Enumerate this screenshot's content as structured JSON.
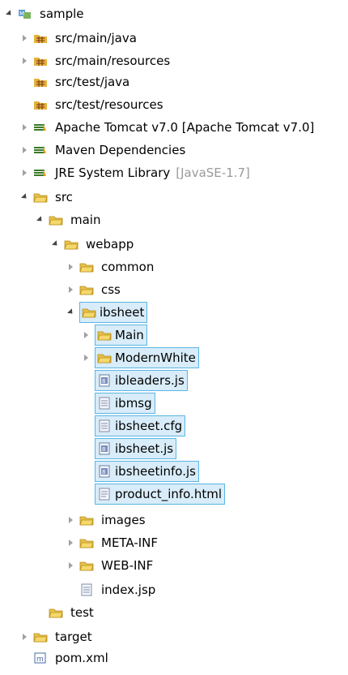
{
  "tree": [
    {
      "label": "sample",
      "icon": "maven-project-icon",
      "arrow": "open",
      "indent": 0,
      "selected": false
    },
    {
      "label": "src/main/java",
      "icon": "source-folder-icon",
      "arrow": "closed",
      "indent": 1,
      "selected": false
    },
    {
      "label": "src/main/resources",
      "icon": "source-folder-icon",
      "arrow": "closed",
      "indent": 1,
      "selected": false
    },
    {
      "label": "src/test/java",
      "icon": "source-folder-icon",
      "arrow": "none",
      "indent": 1,
      "selected": false
    },
    {
      "label": "src/test/resources",
      "icon": "source-folder-icon",
      "arrow": "none",
      "indent": 1,
      "selected": false
    },
    {
      "label": "Apache Tomcat v7.0 [Apache Tomcat v7.0]",
      "icon": "library-icon",
      "arrow": "closed",
      "indent": 1,
      "selected": false
    },
    {
      "label": "Maven Dependencies",
      "icon": "library-icon",
      "arrow": "closed",
      "indent": 1,
      "selected": false
    },
    {
      "label": "JRE System Library",
      "suffix": "[JavaSE-1.7]",
      "icon": "library-icon",
      "arrow": "closed",
      "indent": 1,
      "selected": false
    },
    {
      "label": "src",
      "icon": "folder-icon",
      "arrow": "open",
      "indent": 1,
      "selected": false
    },
    {
      "label": "main",
      "icon": "folder-icon",
      "arrow": "open",
      "indent": 2,
      "selected": false
    },
    {
      "label": "webapp",
      "icon": "folder-icon",
      "arrow": "open",
      "indent": 3,
      "selected": false
    },
    {
      "label": "common",
      "icon": "folder-icon",
      "arrow": "closed",
      "indent": 4,
      "selected": false
    },
    {
      "label": "css",
      "icon": "folder-icon",
      "arrow": "closed",
      "indent": 4,
      "selected": false
    },
    {
      "label": "ibsheet",
      "icon": "folder-icon",
      "arrow": "open",
      "indent": 4,
      "selected": true
    },
    {
      "label": "Main",
      "icon": "folder-icon",
      "arrow": "closed",
      "indent": 5,
      "selected": true
    },
    {
      "label": "ModernWhite",
      "icon": "folder-icon",
      "arrow": "closed",
      "indent": 5,
      "selected": true
    },
    {
      "label": "ibleaders.js",
      "icon": "js-file-icon",
      "arrow": "none",
      "indent": 5,
      "selected": true
    },
    {
      "label": "ibmsg",
      "icon": "text-file-icon",
      "arrow": "none",
      "indent": 5,
      "selected": true
    },
    {
      "label": "ibsheet.cfg",
      "icon": "text-file-icon",
      "arrow": "none",
      "indent": 5,
      "selected": true
    },
    {
      "label": "ibsheet.js",
      "icon": "js-file-icon",
      "arrow": "none",
      "indent": 5,
      "selected": true
    },
    {
      "label": "ibsheetinfo.js",
      "icon": "js-file-icon",
      "arrow": "none",
      "indent": 5,
      "selected": true
    },
    {
      "label": "product_info.html",
      "icon": "html-file-icon",
      "arrow": "none",
      "indent": 5,
      "selected": true
    },
    {
      "label": "images",
      "icon": "folder-icon",
      "arrow": "closed",
      "indent": 4,
      "selected": false
    },
    {
      "label": "META-INF",
      "icon": "folder-icon",
      "arrow": "closed",
      "indent": 4,
      "selected": false
    },
    {
      "label": "WEB-INF",
      "icon": "folder-icon",
      "arrow": "closed",
      "indent": 4,
      "selected": false
    },
    {
      "label": "index.jsp",
      "icon": "jsp-file-icon",
      "arrow": "none",
      "indent": 4,
      "selected": false
    },
    {
      "label": "test",
      "icon": "folder-icon",
      "arrow": "none",
      "indent": 2,
      "selected": false
    },
    {
      "label": "target",
      "icon": "folder-icon",
      "arrow": "closed",
      "indent": 1,
      "selected": false
    },
    {
      "label": "pom.xml",
      "icon": "pom-file-icon",
      "arrow": "none",
      "indent": 1,
      "selected": false
    }
  ]
}
